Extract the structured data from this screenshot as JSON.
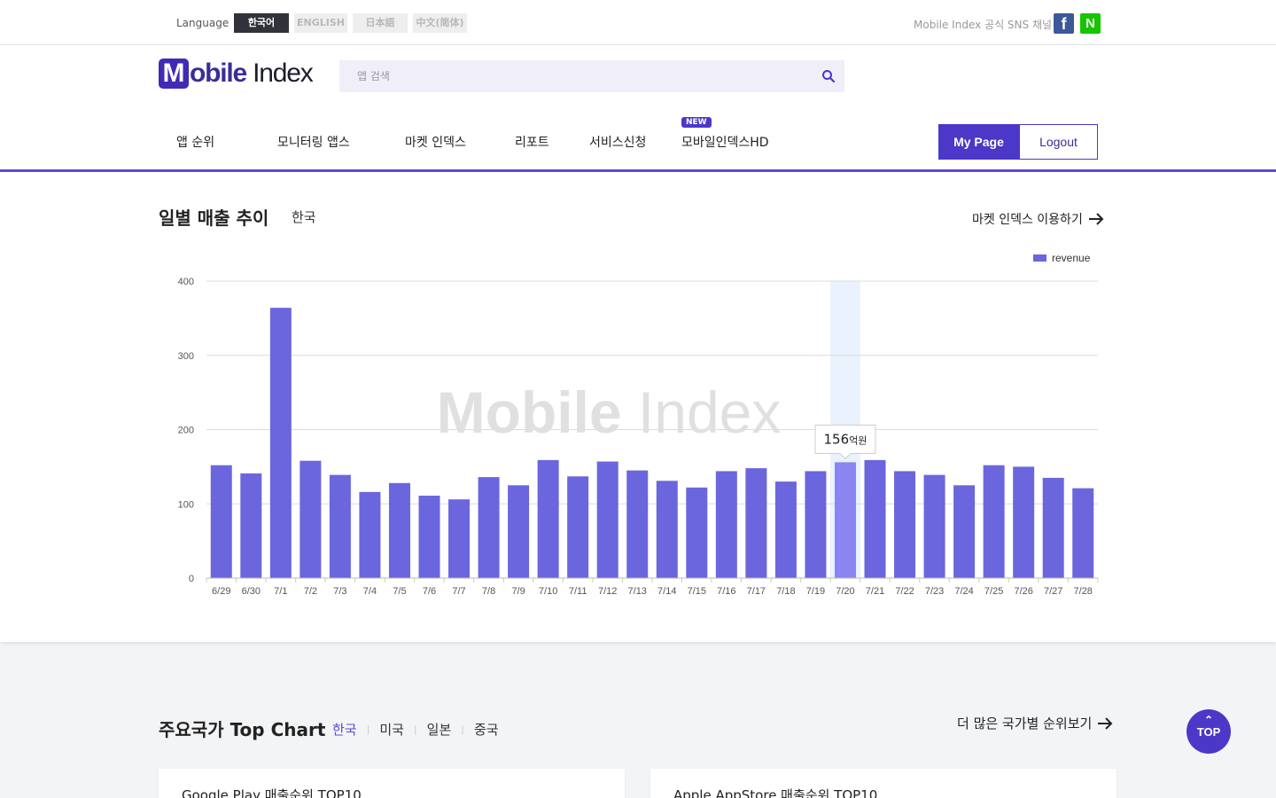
{
  "topbar": {
    "language_label": "Language",
    "languages": [
      "한국어",
      "ENGLISH",
      "日本語",
      "中文(简体)"
    ],
    "active_language": "한국어",
    "sns_label": "Mobile Index 공식 SNS 채널",
    "facebook_icon": "f",
    "naver_icon": "N"
  },
  "header": {
    "logo_m": "M",
    "logo_text_1": "obile",
    "logo_text_2": " Index",
    "search_placeholder": "앱 검색",
    "nav": [
      "앱 순위",
      "모니터링 앱스",
      "마켓 인덱스",
      "리포트",
      "서비스신청",
      "모바일인덱스HD"
    ],
    "new_badge": "NEW",
    "mypage_label": "My Page",
    "logout_label": "Logout"
  },
  "chart_section": {
    "title": "일별 매출 추이",
    "region": "한국",
    "link_label": "마켓 인덱스 이용하기",
    "watermark_1": "Mobile",
    "watermark_2": "Index",
    "tooltip_value": "156",
    "tooltip_unit": "억원"
  },
  "chart_data": {
    "type": "bar",
    "categories": [
      "6/29",
      "6/30",
      "7/1",
      "7/2",
      "7/3",
      "7/4",
      "7/5",
      "7/6",
      "7/7",
      "7/8",
      "7/9",
      "7/10",
      "7/11",
      "7/12",
      "7/13",
      "7/14",
      "7/15",
      "7/16",
      "7/17",
      "7/18",
      "7/19",
      "7/20",
      "7/21",
      "7/22",
      "7/23",
      "7/24",
      "7/25",
      "7/26",
      "7/27",
      "7/28"
    ],
    "series": [
      {
        "name": "revenue",
        "values": [
          152,
          141,
          364,
          158,
          139,
          116,
          128,
          111,
          106,
          136,
          125,
          159,
          137,
          157,
          145,
          131,
          122,
          144,
          148,
          130,
          144,
          156,
          159,
          144,
          139,
          125,
          152,
          150,
          135,
          121
        ]
      }
    ],
    "ylim": [
      0,
      400
    ],
    "yticks": [
      0,
      100,
      200,
      300,
      400
    ],
    "highlight_index": 21,
    "legend_position": "top-right",
    "grid": true,
    "bar_color": "#6b66dd",
    "highlight_color": "#8a85f0"
  },
  "top_chart": {
    "title": "주요국가 Top Chart",
    "tabs": [
      "한국",
      "미국",
      "일본",
      "중국"
    ],
    "active_tab": "한국",
    "link_label": "더 많은 국가별 순위보기",
    "card_google": "Google Play 매출순위 TOP10",
    "card_apple": "Apple AppStore 매출순위 TOP10"
  },
  "top_button": "TOP"
}
